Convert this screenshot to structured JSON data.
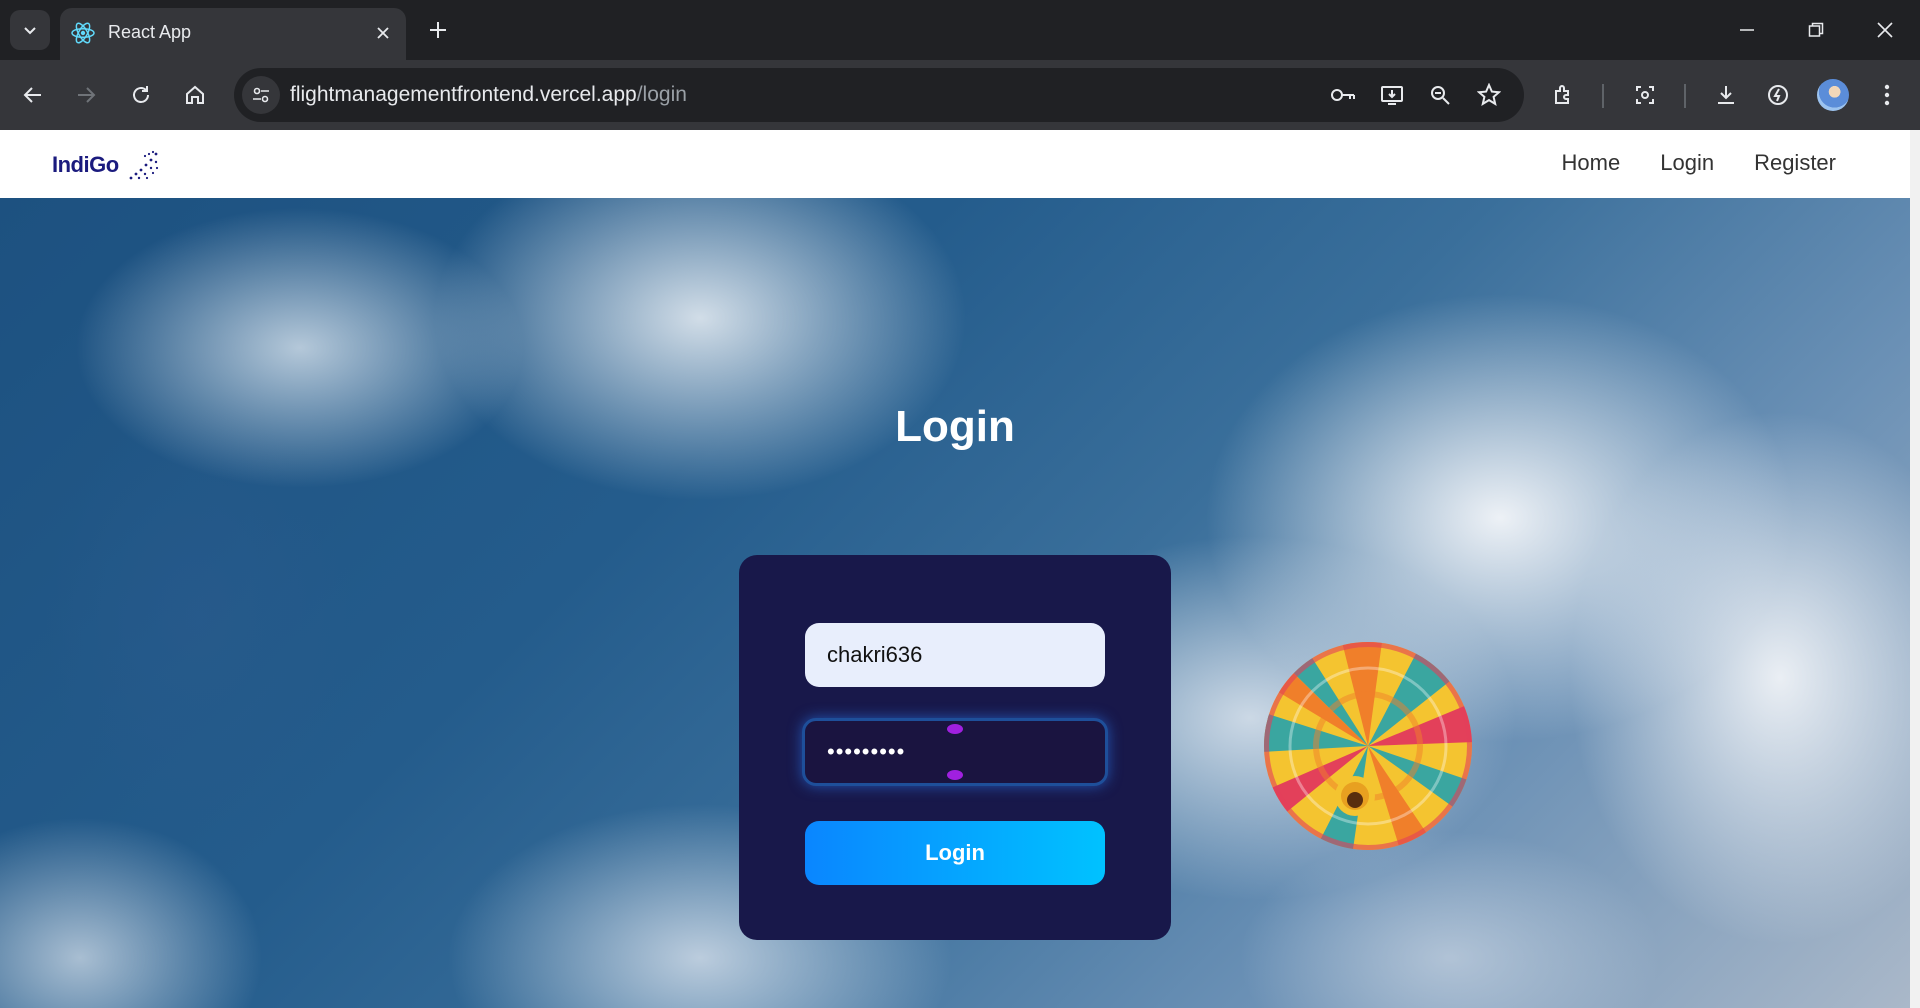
{
  "browser": {
    "tab_title": "React App",
    "url_host": "flightmanagementfrontend.vercel.app",
    "url_path": "/login"
  },
  "navbar": {
    "brand": "IndiGo",
    "links": [
      "Home",
      "Login",
      "Register"
    ]
  },
  "login": {
    "title": "Login",
    "username_value": "chakri636",
    "password_masked": "•••••••••",
    "submit_label": "Login"
  },
  "colors": {
    "card_bg": "#18184a",
    "button_start": "#0a86ff",
    "button_end": "#00c2ff",
    "brand_text": "#1b1b7e"
  },
  "icons": [
    "tab-search-icon",
    "react-favicon-icon",
    "close-icon",
    "plus-icon",
    "minimize-icon",
    "restore-icon",
    "window-close-icon",
    "back-icon",
    "forward-icon",
    "reload-icon",
    "home-icon",
    "site-info-icon",
    "key-icon",
    "install-icon",
    "zoom-icon",
    "star-icon",
    "extensions-icon",
    "screenshot-icon",
    "download-icon",
    "performance-icon",
    "menu-icon"
  ]
}
